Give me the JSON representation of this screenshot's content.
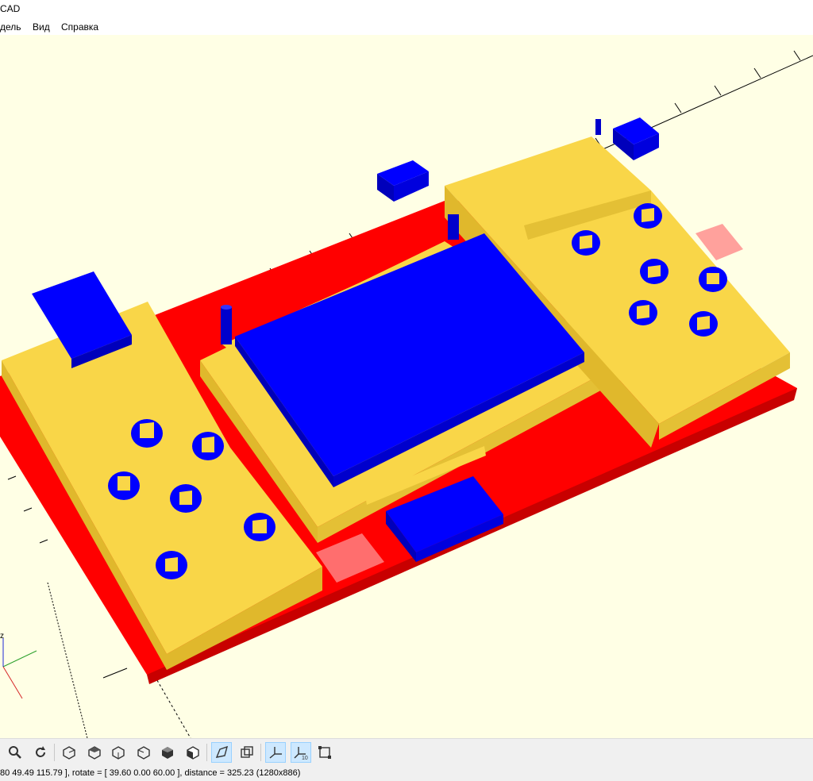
{
  "window": {
    "title": "CAD"
  },
  "menu": {
    "items": [
      "дель",
      "Вид",
      "Справка"
    ]
  },
  "viewport": {
    "colors": {
      "background": "#ffffe5",
      "pcb": "#ff0000",
      "case": "#f9d648",
      "components": "#0000ff",
      "highlight": "#ff8a8a"
    },
    "axis_label": "z"
  },
  "toolbar": {
    "buttons": [
      {
        "name": "zoom-icon",
        "active": false
      },
      {
        "name": "reset-view-icon",
        "active": false
      },
      {
        "name": "view-right-icon",
        "active": false
      },
      {
        "name": "view-top-icon",
        "active": false
      },
      {
        "name": "view-bottom-icon",
        "active": false
      },
      {
        "name": "view-left-icon",
        "active": false
      },
      {
        "name": "view-front-icon",
        "active": false
      },
      {
        "name": "view-back-icon",
        "active": false
      },
      {
        "name": "perspective-icon",
        "active": true
      },
      {
        "name": "orthogonal-icon",
        "active": false
      },
      {
        "name": "show-axes-icon",
        "active": true
      },
      {
        "name": "show-scale-markers-icon",
        "active": true
      },
      {
        "name": "show-edges-icon",
        "active": false
      }
    ]
  },
  "status": {
    "text": "80 49.49 115.79 ], rotate = [ 39.60 0.00 60.00 ], distance = 325.23 (1280x886)"
  }
}
